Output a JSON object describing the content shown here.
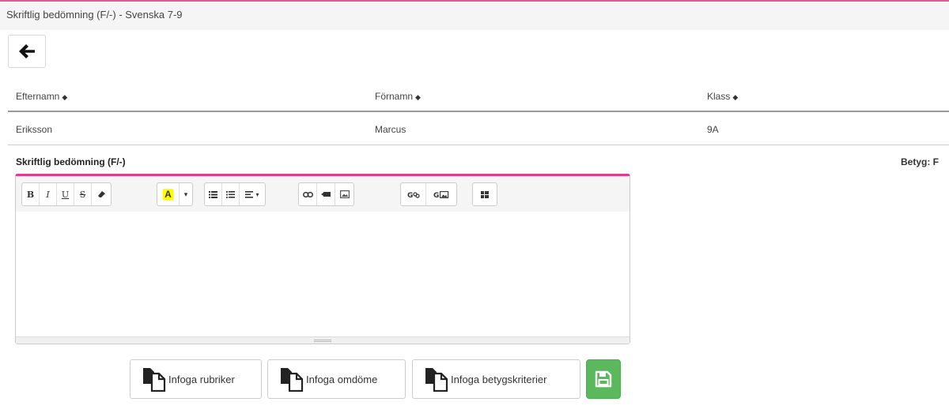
{
  "window": {
    "title": "Skriftlig bedömning (F/-) - Svenska 7-9"
  },
  "colors": {
    "accent": "#e03c8c",
    "save": "#5cb85c",
    "highlight": "#ffff00"
  },
  "table": {
    "columns": [
      {
        "label": "Efternamn",
        "icon": "sort-icon"
      },
      {
        "label": "Förnamn",
        "icon": "sort-icon"
      },
      {
        "label": "Klass",
        "icon": "sort-icon"
      }
    ],
    "rows": [
      {
        "efternamn": "Eriksson",
        "fornamn": "Marcus",
        "klass": "9A"
      }
    ]
  },
  "assessment": {
    "label": "Skriftlig bedömning (F/-)",
    "grade": "Betyg: F"
  },
  "editor": {
    "content": "",
    "toolbar": {
      "bold": "B",
      "italic": "I",
      "underline": "U",
      "strikethrough": "S",
      "dropdown_caret": "▾",
      "highlight": "A"
    }
  },
  "actions": {
    "insert_headings": "Infoga rubriker",
    "insert_comment": "Infoga omdöme",
    "insert_criteria": "Infoga betygskriterier"
  }
}
